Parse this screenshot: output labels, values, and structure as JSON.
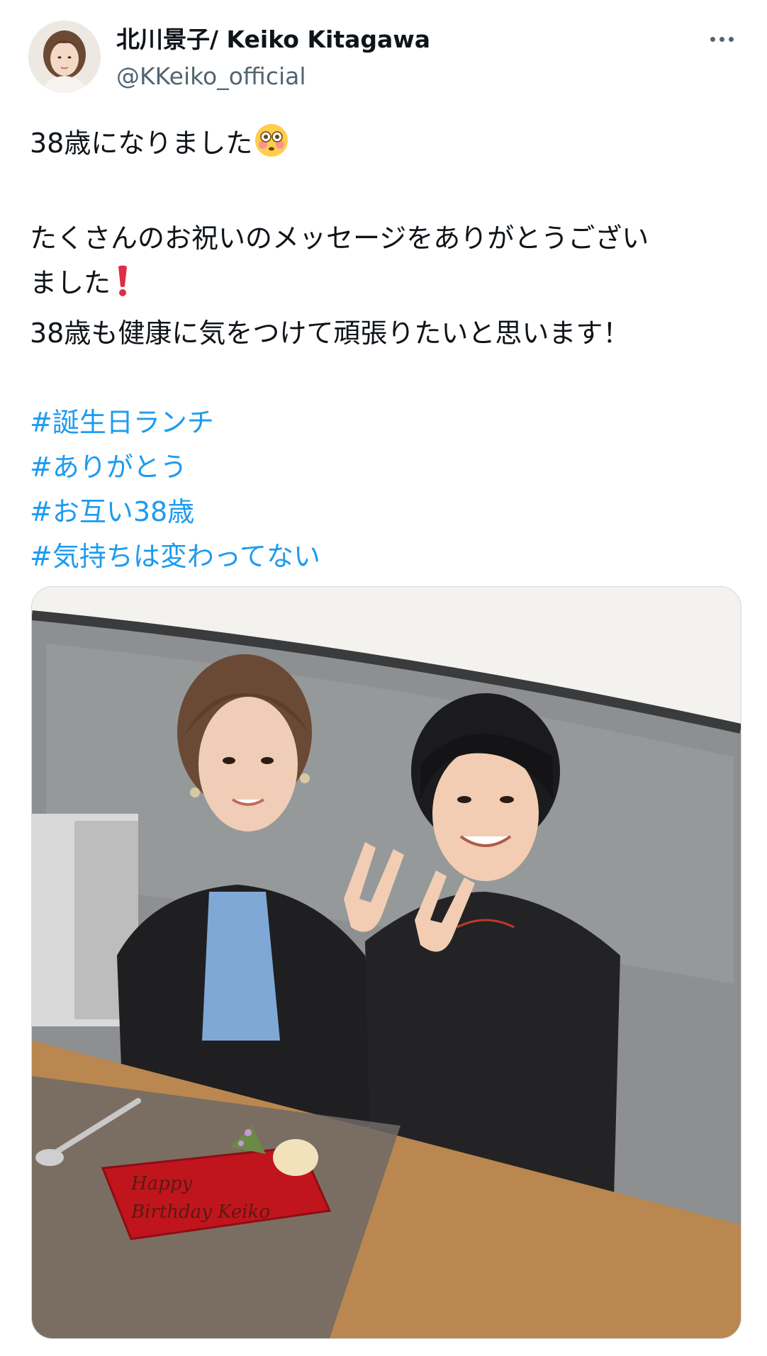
{
  "author": {
    "display_name": "北川景子/ Keiko Kitagawa",
    "handle": "@KKeiko_official",
    "avatar_icon": "profile-photo"
  },
  "menu": {
    "icon": "more-horizontal-icon"
  },
  "tweet": {
    "line1": "38歳になりました",
    "line1_emoji": "flushed-face-emoji",
    "line2": "たくさんのお祝いのメッセージをありがとうござい",
    "line3": "ました",
    "line3_emoji": "red-exclamation-emoji",
    "line4": "38歳も健康に気をつけて頑張りたいと思います！",
    "hashtags": [
      "#誕生日ランチ",
      "#ありがとう",
      "#お互い38歳",
      "#気持ちは変わってない"
    ]
  },
  "media": {
    "photo_icon": "birthday-lunch-photo",
    "plate_text_line1": "Happy",
    "plate_text_line2": "Birthday Keiko"
  },
  "colors": {
    "text": "#0f1419",
    "secondary_text": "#536471",
    "hashtag": "#1d9bf0",
    "border": "#cfd9de"
  }
}
